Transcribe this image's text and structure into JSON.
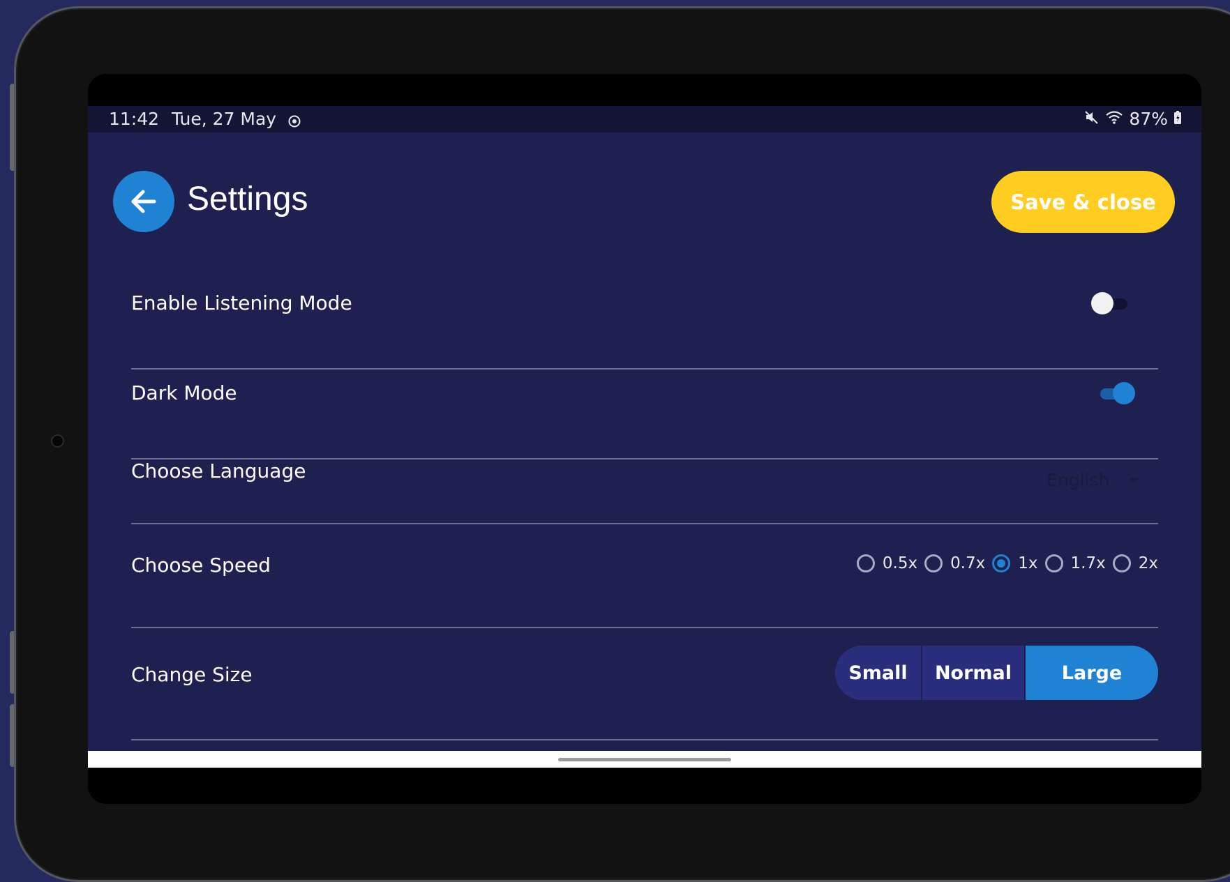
{
  "status_bar": {
    "time": "11:42",
    "date": "Tue, 27 May",
    "battery": "87%"
  },
  "header": {
    "title": "Settings",
    "save_label": "Save & close"
  },
  "settings": {
    "listening": {
      "label": "Enable Listening Mode",
      "enabled": false
    },
    "dark_mode": {
      "label": "Dark Mode",
      "enabled": true
    },
    "language": {
      "label": "Choose Language",
      "selected": "English"
    },
    "speed": {
      "label": "Choose Speed",
      "options": [
        "0.5x",
        "0.7x",
        "1x",
        "1.7x",
        "2x"
      ],
      "selected": "1x"
    },
    "size": {
      "label": "Change Size",
      "options": [
        "Small",
        "Normal",
        "Large"
      ],
      "selected": "Large"
    }
  },
  "colors": {
    "background": "#1e2150",
    "accent": "#1f82d2",
    "save_button": "#ffcd1f",
    "segment": "#2a2e7d"
  }
}
